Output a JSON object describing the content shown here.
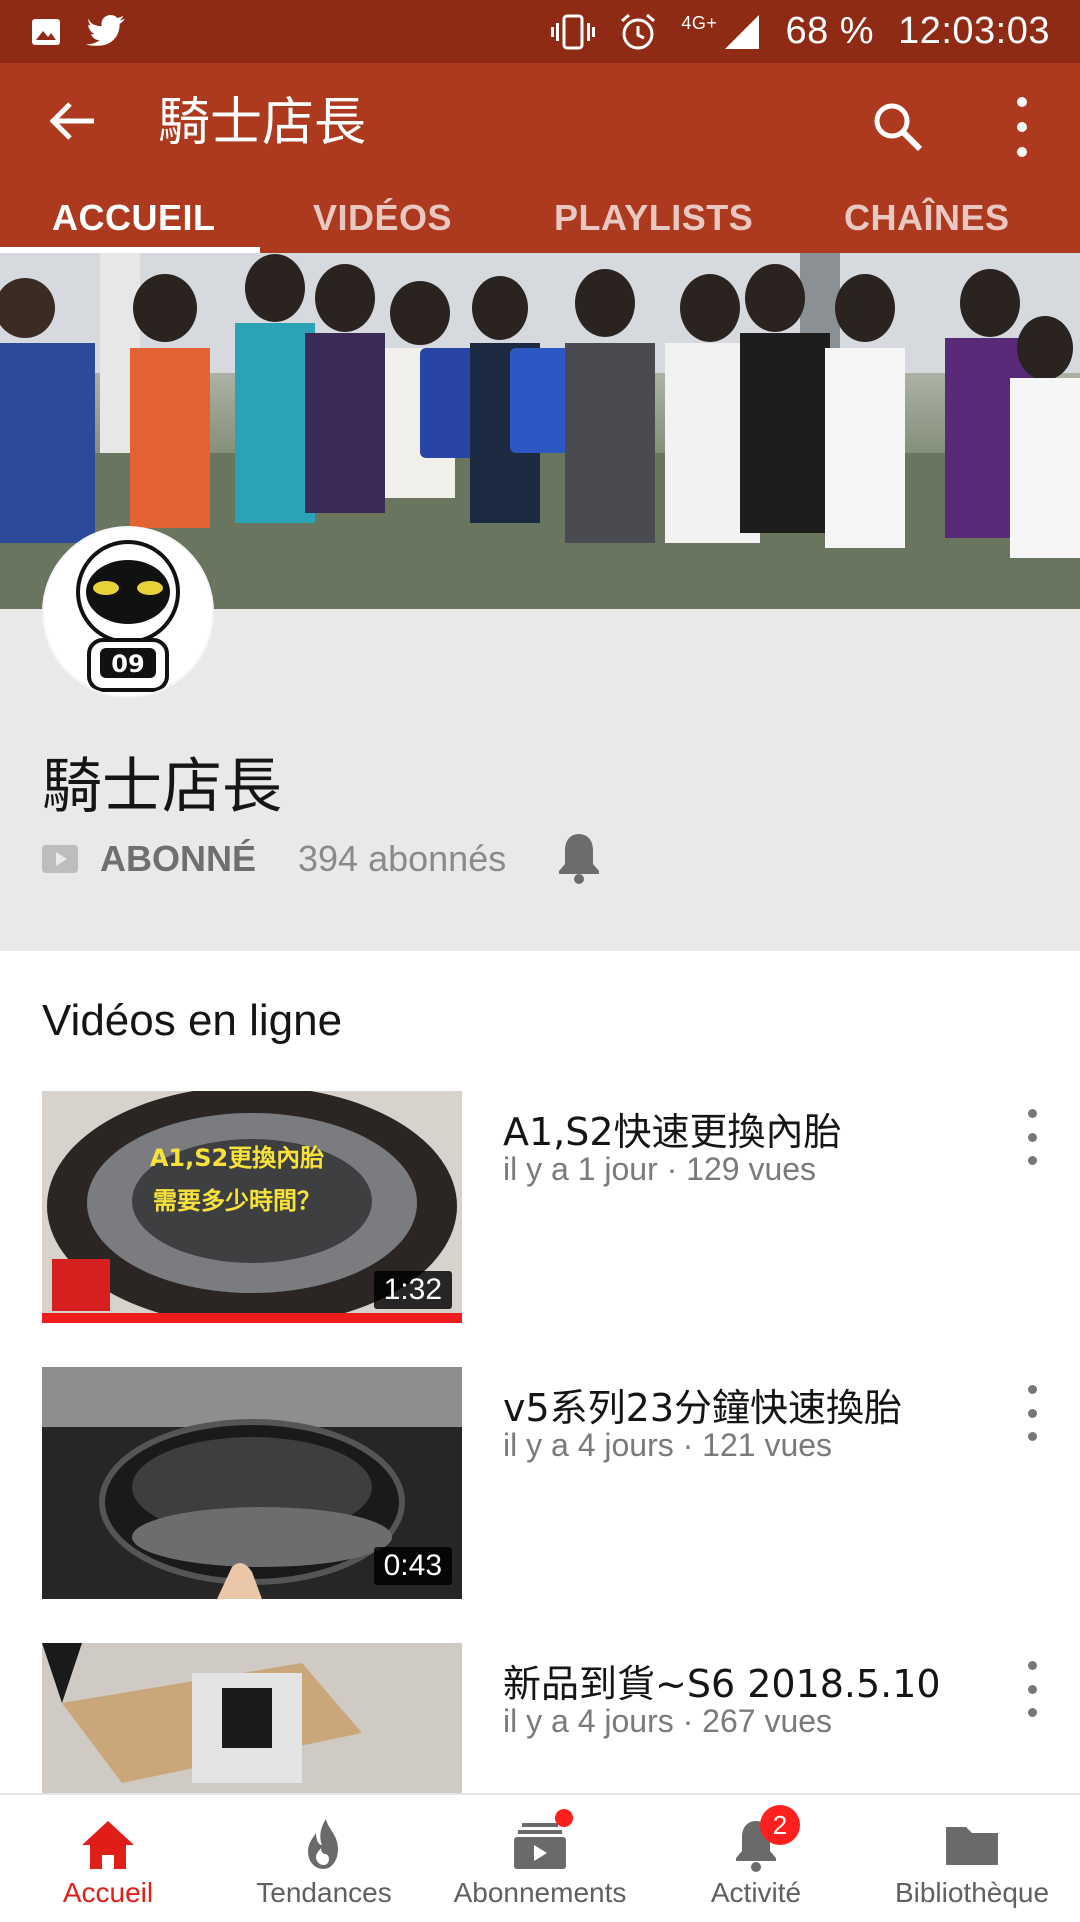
{
  "status_bar": {
    "battery": "68 %",
    "time": "12:03:03",
    "network": "4G+",
    "icons": [
      "gallery-icon",
      "twitter-icon",
      "vibrate-icon",
      "alarm-icon",
      "signal-icon"
    ]
  },
  "app_bar": {
    "title": "騎士店長",
    "tabs": [
      {
        "label": "ACCUEIL",
        "active": true
      },
      {
        "label": "VIDÉOS",
        "active": false
      },
      {
        "label": "PLAYLISTS",
        "active": false
      },
      {
        "label": "CHAÎNES",
        "active": false
      }
    ]
  },
  "channel": {
    "name": "騎士店長",
    "subscribe_label": "ABONNÉ",
    "subscriber_count": "394 abonnés",
    "avatar_text": "09"
  },
  "section": {
    "title": "Vidéos en ligne"
  },
  "videos": [
    {
      "title": "A1,S2快速更換內胎",
      "meta": "il y a 1 jour · 129 vues",
      "duration": "1:32",
      "thumb_caption_1": "A1,S2更換內胎",
      "thumb_caption_2": "需要多少時間？"
    },
    {
      "title": "v5系列23分鐘快速換胎",
      "meta": "il y a 4 jours · 121 vues",
      "duration": "0:43"
    },
    {
      "title": "新品到貨~S6 2018.5.10",
      "meta": "il y a 4 jours · 267 vues",
      "duration": ""
    }
  ],
  "bottom_nav": {
    "items": [
      {
        "label": "Accueil",
        "icon": "home-icon",
        "active": true
      },
      {
        "label": "Tendances",
        "icon": "flame-icon",
        "active": false
      },
      {
        "label": "Abonnements",
        "icon": "subscriptions-icon",
        "active": false
      },
      {
        "label": "Activité",
        "icon": "bell-icon",
        "active": false,
        "badge": "2"
      },
      {
        "label": "Bibliothèque",
        "icon": "folder-icon",
        "active": false
      }
    ]
  },
  "colors": {
    "status_bar": "#8f2b14",
    "app_bar": "#ad3a1f",
    "active_nav": "#e01e18",
    "panel": "#e9e9e9"
  }
}
